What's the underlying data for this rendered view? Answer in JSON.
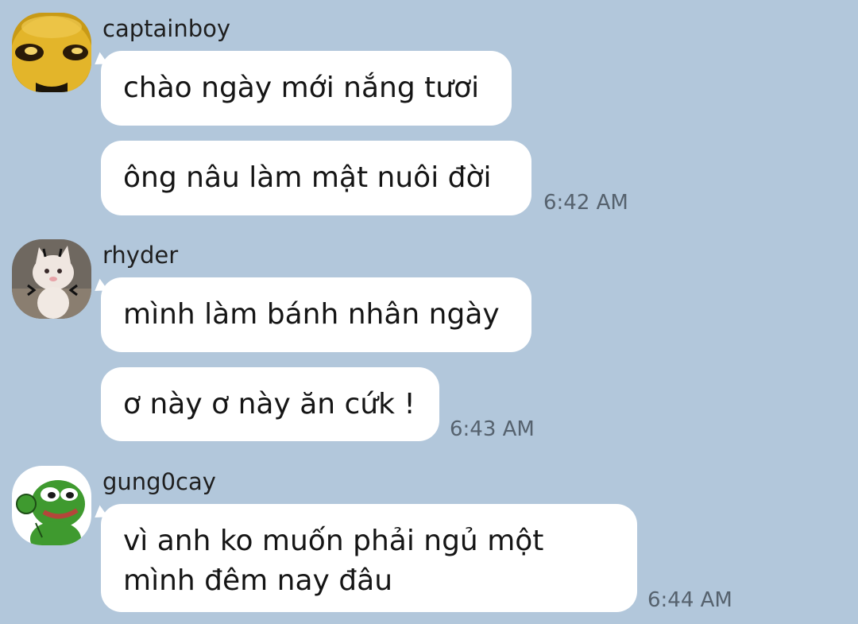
{
  "messages": [
    {
      "sender": "captainboy",
      "avatar": "cartoon-face-avatar",
      "lines": [
        "chào ngày mới nắng tươi",
        "ông nâu làm mật nuôi đời"
      ],
      "time": "6:42 AM"
    },
    {
      "sender": "rhyder",
      "avatar": "kitten-avatar",
      "lines": [
        "mình làm bánh nhân ngày",
        "ơ này ơ này ăn cứk !"
      ],
      "time": "6:43 AM"
    },
    {
      "sender": "gung0cay",
      "avatar": "frog-avatar",
      "lines": [
        "vì anh ko muốn phải ngủ một mình đêm nay đâu"
      ],
      "time": "6:44 AM"
    }
  ],
  "colors": {
    "background": "#b2c7db",
    "bubble": "#ffffff",
    "timestamp": "#56626e"
  }
}
